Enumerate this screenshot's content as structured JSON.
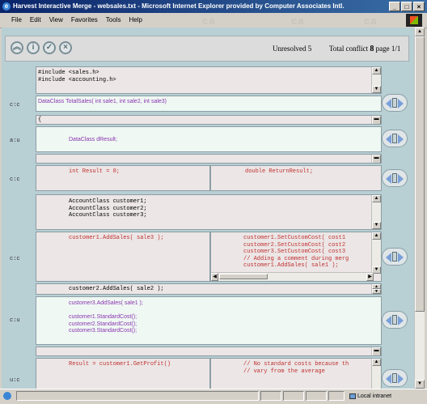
{
  "window": {
    "title": "Harvest Interactive Merge - websales.txt - Microsoft Internet Explorer provided by Computer Associates Intl.",
    "controls": [
      "_",
      "□",
      "×"
    ]
  },
  "menubar": {
    "items": [
      "File",
      "Edit",
      "View",
      "Favorites",
      "Tools",
      "Help"
    ],
    "watermark": "ca"
  },
  "toolbar": {
    "icons": [
      "up-arrows-icon",
      "info-icon",
      "check-icon",
      "cancel-icon"
    ],
    "unresolved_label": "Unresolved 5",
    "total_conflict_label": "Total conflict",
    "total_conflict_count": "8",
    "page_label": "page 1/1"
  },
  "blocks": [
    {
      "label": "",
      "lines": [
        "#include <sales.h>",
        "#include <accounting.h>"
      ]
    },
    {
      "label": "c:c",
      "lines": [
        "DataClass TotalSales( int sale1, int sale2, int sale3)"
      ]
    },
    {
      "label": "",
      "lines": [
        "{"
      ]
    },
    {
      "label": "a:u",
      "lines": [
        "DataClass dResult;"
      ]
    },
    {
      "label": "",
      "lines": [
        ""
      ]
    },
    {
      "label": "c:c",
      "left": [
        "int Result = 0;"
      ],
      "right": [
        "double ReturnResult;"
      ]
    },
    {
      "label": "",
      "lines": [
        "AccountClass customer1;",
        "AccountClass customer2;",
        "AccountClass customer3;"
      ]
    },
    {
      "label": "c:c",
      "left": [
        "customer1.AddSales( sale3 );"
      ],
      "right": [
        "customer1.SetCustomCost( cost1",
        "customer2.SetCustomCost( cost2",
        "customer3.SetCustomCost( cost3",
        "// Adding a comment during merg",
        "customer1.AddSales( sale1 );"
      ]
    },
    {
      "label": "",
      "lines": [
        "customer2.AddSales( sale2 );"
      ]
    },
    {
      "label": "c:u",
      "lines": [
        "customer3.AddSales( sale1 );",
        "",
        "customer1.StandardCost();",
        "customer2.StandardCost();",
        "customer3.StandardCost();"
      ]
    },
    {
      "label": "",
      "lines": [
        ""
      ]
    },
    {
      "label": "u:c",
      "left": [
        "Result = customer1.GetProfit()"
      ],
      "right": [
        "// No standard costs because th",
        "// vary from the average"
      ]
    }
  ],
  "statusbar": {
    "zone": "Local intranet"
  }
}
